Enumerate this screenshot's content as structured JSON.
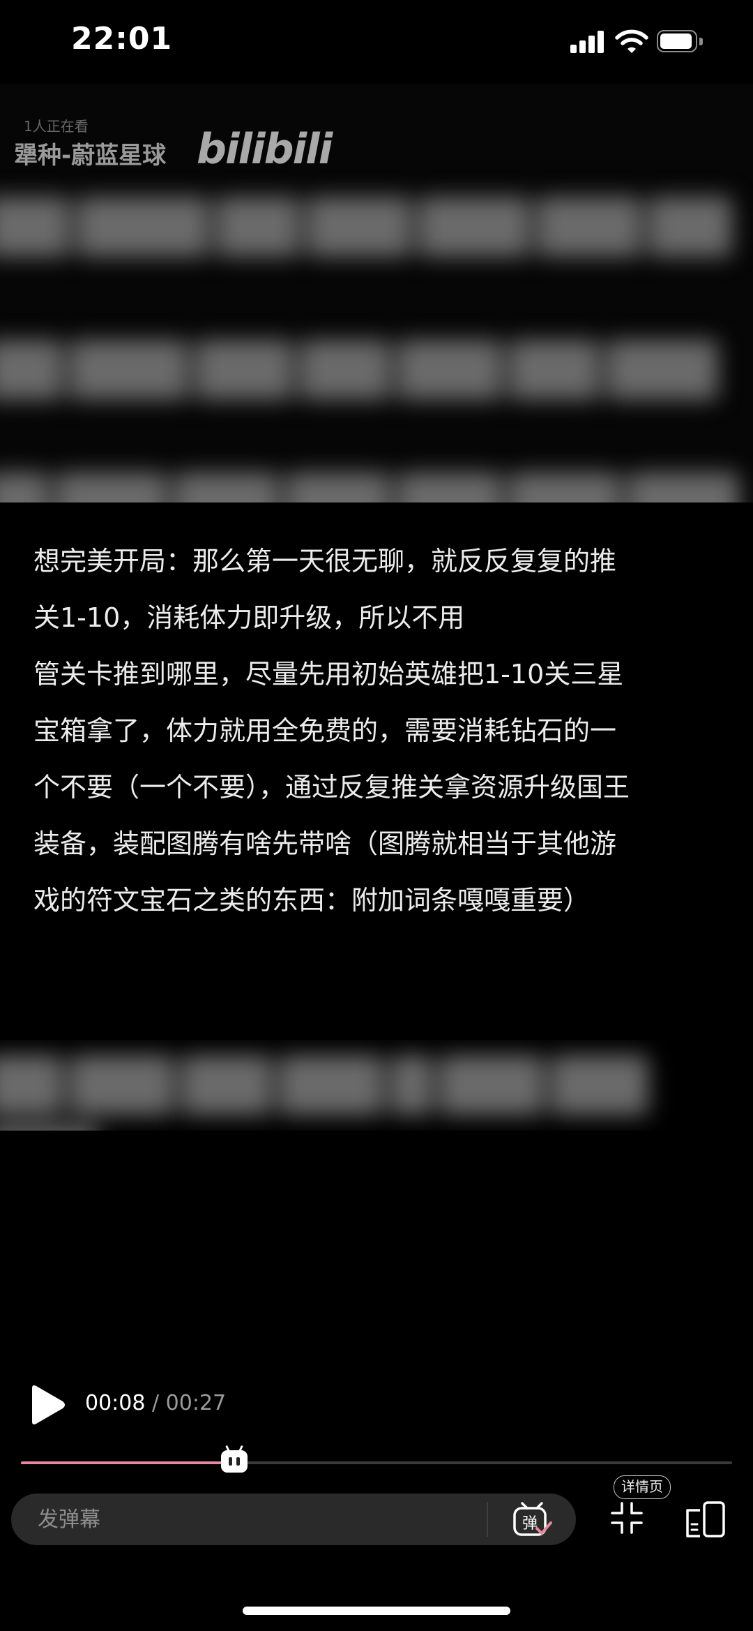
{
  "status_bar": {
    "time": "22:01",
    "signal_icon": "cellular-signal-icon",
    "wifi_icon": "wifi-icon",
    "battery_icon": "battery-icon"
  },
  "video": {
    "viewers": "1人正在看",
    "up_name": "犟种-蔚蓝星球",
    "logo": "bilibili"
  },
  "content": {
    "lines": [
      "想完美开局：那么第一天很无聊，就反反复复的推",
      "关1-10，消耗体力即升级，所以不用",
      "管关卡推到哪里，尽量先用初始英雄把1-10关三星",
      "宝箱拿了，体力就用全免费的，需要消耗钻石的一",
      "个不要（一个不要），通过反复推关拿资源升级国王",
      "装备，装配图腾有啥先带啥（图腾就相当于其他游",
      "戏的符文宝石之类的东西：附加词条嘎嘎重要）"
    ]
  },
  "player": {
    "current_time": "00:08",
    "separator": " / ",
    "total_time": "00:27",
    "progress": 0.3,
    "played_color": "#e88aa1",
    "danmaku_placeholder": "发弹幕",
    "danmaku_toggle_icon": "danmaku-toggle-icon",
    "detail_label": "详情页",
    "exit_fullscreen_icon": "exit-fullscreen-icon",
    "split_screen_icon": "split-screen-icon"
  }
}
